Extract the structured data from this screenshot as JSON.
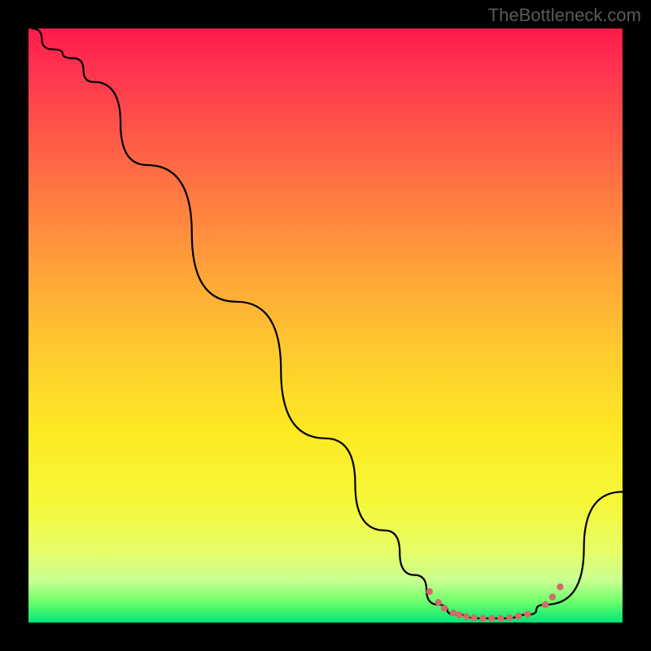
{
  "attribution": "TheBottleneck.com",
  "chart_data": {
    "type": "line",
    "title": "",
    "xlabel": "",
    "ylabel": "",
    "xlim": [
      0,
      100
    ],
    "ylim": [
      0,
      100
    ],
    "curve_points": [
      {
        "x": 0.5,
        "y": 100
      },
      {
        "x": 4,
        "y": 96.5
      },
      {
        "x": 7.5,
        "y": 95
      },
      {
        "x": 11,
        "y": 91
      },
      {
        "x": 20,
        "y": 77
      },
      {
        "x": 35,
        "y": 54
      },
      {
        "x": 50,
        "y": 31
      },
      {
        "x": 60,
        "y": 15.5
      },
      {
        "x": 65,
        "y": 8
      },
      {
        "x": 69,
        "y": 3
      },
      {
        "x": 72,
        "y": 1.3
      },
      {
        "x": 76,
        "y": 0.7
      },
      {
        "x": 80,
        "y": 0.7
      },
      {
        "x": 84,
        "y": 1.3
      },
      {
        "x": 87,
        "y": 3
      },
      {
        "x": 100,
        "y": 22
      }
    ],
    "markers": [
      {
        "x": 67.5,
        "y": 5.2
      },
      {
        "x": 69.0,
        "y": 3.4
      },
      {
        "x": 70.0,
        "y": 2.4
      },
      {
        "x": 71.5,
        "y": 1.6
      },
      {
        "x": 72.5,
        "y": 1.3
      },
      {
        "x": 73.7,
        "y": 1.0
      },
      {
        "x": 75.0,
        "y": 0.8
      },
      {
        "x": 76.5,
        "y": 0.7
      },
      {
        "x": 78.0,
        "y": 0.7
      },
      {
        "x": 79.5,
        "y": 0.7
      },
      {
        "x": 81.0,
        "y": 0.8
      },
      {
        "x": 82.5,
        "y": 1.1
      },
      {
        "x": 84.0,
        "y": 1.4
      },
      {
        "x": 87.0,
        "y": 3.0
      },
      {
        "x": 88.2,
        "y": 4.3
      },
      {
        "x": 89.5,
        "y": 6.0
      }
    ],
    "gradient_colors": {
      "top": "#ff1a4a",
      "middle": "#ffe030",
      "bottom": "#00e676"
    }
  }
}
